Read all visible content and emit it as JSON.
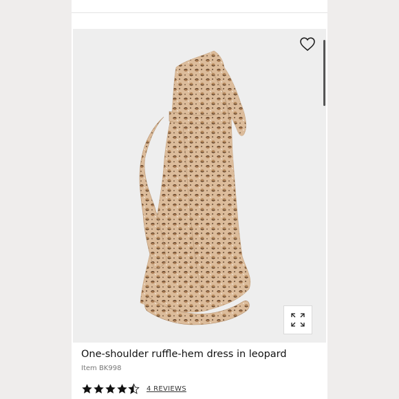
{
  "product": {
    "title": "One-shoulder ruffle-hem dress in leopard",
    "item_number": "Item BK998",
    "rating": 4.5,
    "reviews_label": "4 REVIEWS"
  },
  "icons": {
    "favorite": "heart-icon",
    "expand": "expand-icon",
    "rating": "star-icon"
  },
  "colors": {
    "accent": "#111111",
    "image_background": "#eeeeee",
    "dress_base": "#d9b896",
    "dress_spot": "#5a3a22"
  }
}
